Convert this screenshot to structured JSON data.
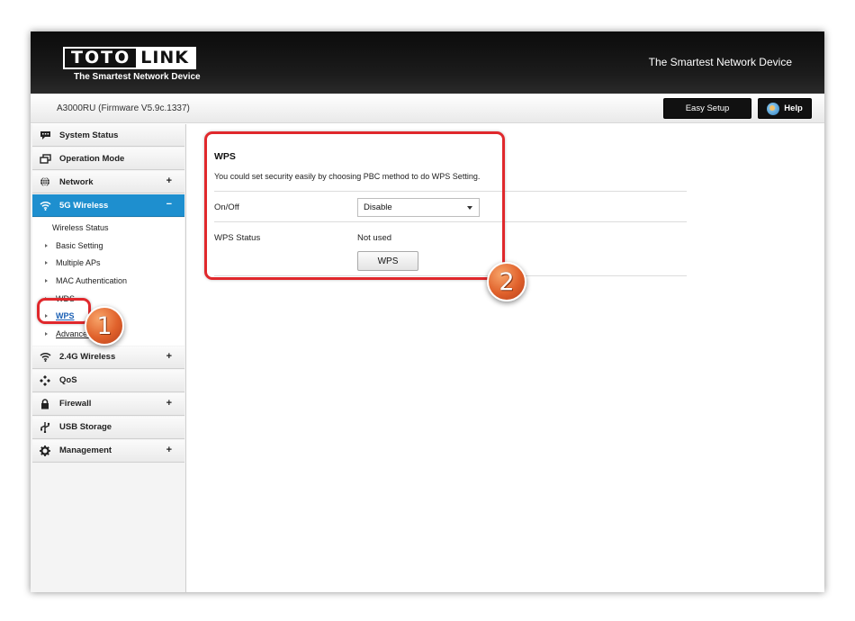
{
  "header": {
    "logo_left": "TOTO",
    "logo_right": "LINK",
    "logo_tagline": "The Smartest Network Device",
    "slogan": "The Smartest Network Device"
  },
  "subheader": {
    "model": "A3000RU (Firmware V5.9c.1337)",
    "easy_setup_label": "Easy Setup",
    "help_label": "Help"
  },
  "sidebar": {
    "items": [
      {
        "label": "System Status",
        "icon": "chat-icon",
        "expand": ""
      },
      {
        "label": "Operation Mode",
        "icon": "windows-icon",
        "expand": ""
      },
      {
        "label": "Network",
        "icon": "globe-icon",
        "expand": "+"
      },
      {
        "label": "5G Wireless",
        "icon": "wifi-icon",
        "expand": "−"
      },
      {
        "label": "2.4G Wireless",
        "icon": "wifi-icon",
        "expand": "+"
      },
      {
        "label": "QoS",
        "icon": "qos-icon",
        "expand": ""
      },
      {
        "label": "Firewall",
        "icon": "lock-icon",
        "expand": "+"
      },
      {
        "label": "USB Storage",
        "icon": "usb-icon",
        "expand": ""
      },
      {
        "label": "Management",
        "icon": "gear-icon",
        "expand": "+"
      }
    ],
    "submenu_5g": [
      {
        "label": "Wireless Status"
      },
      {
        "label": "Basic Setting"
      },
      {
        "label": "Multiple APs"
      },
      {
        "label": "MAC Authentication"
      },
      {
        "label": "WDS"
      },
      {
        "label": "WPS"
      },
      {
        "label": "Advanced"
      }
    ]
  },
  "main": {
    "title": "WPS",
    "description": "You could set security easily by choosing PBC method to do WPS Setting.",
    "onoff_label": "On/Off",
    "onoff_value": "Disable",
    "status_label": "WPS Status",
    "status_value": "Not used",
    "wps_button": "WPS"
  },
  "annotations": {
    "badge1": "1",
    "badge2": "2",
    "highlight_color": "#e0282c",
    "badge_color": "#e0612b"
  },
  "colors": {
    "active_menu": "#1e8fcf",
    "topbar": "#111111"
  }
}
